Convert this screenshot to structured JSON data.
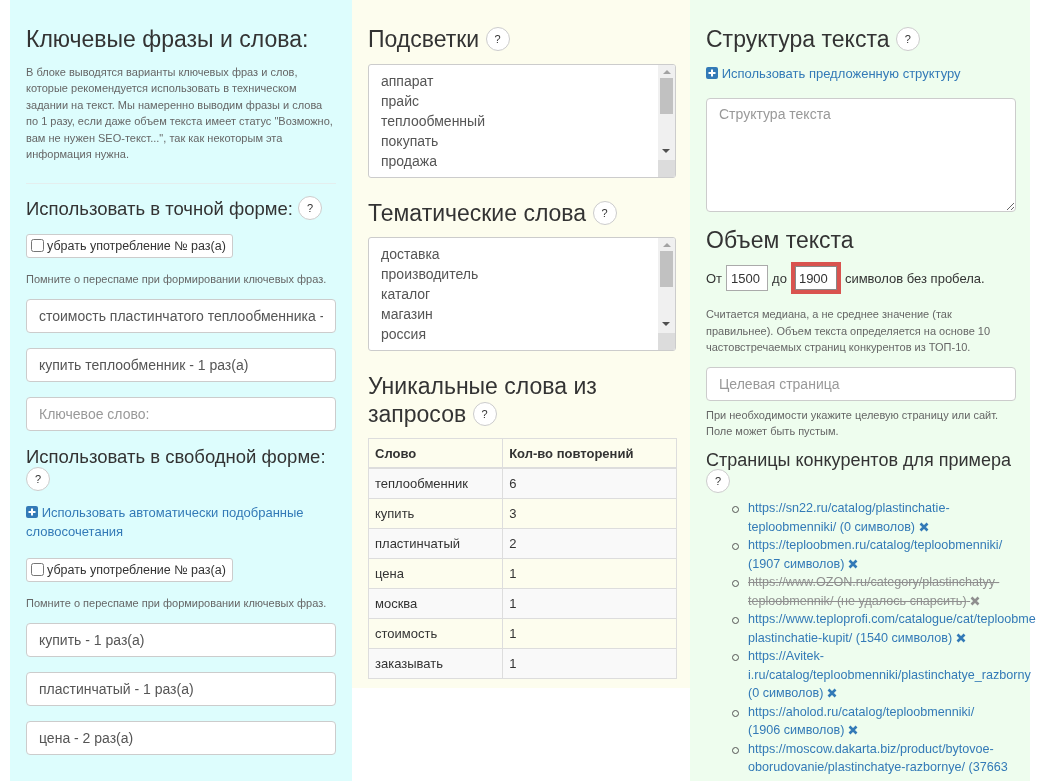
{
  "keywords": {
    "title": "Ключевые фразы и слова:",
    "description": "В блоке выводятся варианты ключевых фраз и слов, которые рекомендуется использовать в техническом задании на текст. Мы намеренно выводим фразы и слова по 1 разу, если даже объем текста имеет статус \"Возможно, вам не нужен SEO-текст...\", так как некоторым эта информация нужна.",
    "exact": {
      "heading": "Использовать в точной форме:",
      "help": "?",
      "remove_count": {
        "label": "убрать употребление № раз(а)",
        "checked": false
      },
      "hint": "Помните о переспаме при формировании ключевых фраз.",
      "phrases": [
        {
          "value": "стоимость пластинчатого теплообменника -"
        },
        {
          "value": "купить теплообменник - 1 раз(а)"
        },
        {
          "placeholder": "Ключевое слово:"
        }
      ]
    },
    "free": {
      "heading": "Использовать в свободной форме:",
      "help": "?",
      "link": "Использовать автоматически подобранные словосочетания",
      "remove_count": {
        "label": "убрать употребление № раз(а)",
        "checked": false
      },
      "hint": "Помните о переспаме при формировании ключевых фраз.",
      "phrases": [
        {
          "value": "купить - 1 раз(а)"
        },
        {
          "value": "пластинчатый - 1 раз(а)"
        },
        {
          "value": "цена - 2 раз(а)"
        }
      ]
    }
  },
  "highlights": {
    "title": "Подсветки",
    "help": "?",
    "items": [
      "аппарат",
      "прайс",
      "теплообменный",
      "покупать",
      "продажа"
    ]
  },
  "thematic": {
    "title": "Тематические слова",
    "help": "?",
    "items": [
      "доставка",
      "производитель",
      "каталог",
      "магазин",
      "россия"
    ]
  },
  "unique_words": {
    "title_lines": [
      "Уникальные слова из",
      "запросов"
    ],
    "help": "?",
    "columns": [
      "Слово",
      "Кол-во повторений"
    ],
    "rows": [
      [
        "теплообменник",
        "6"
      ],
      [
        "купить",
        "3"
      ],
      [
        "пластинчатый",
        "2"
      ],
      [
        "цена",
        "1"
      ],
      [
        "москва",
        "1"
      ],
      [
        "стоимость",
        "1"
      ],
      [
        "заказывать",
        "1"
      ]
    ]
  },
  "structure": {
    "title": "Структура текста",
    "help": "?",
    "link": "Использовать предложенную структуру",
    "placeholder": "Структура текста"
  },
  "volume": {
    "title": "Объем текста",
    "from_label": "От",
    "from_value": "1500",
    "to_label": "до",
    "to_value": "1900",
    "to_highlighted": true,
    "suffix": "символов без пробела.",
    "note": "Считается медиана, а не среднее значение (так правильнее). Объем текста определяется на основе 10 частовстречаемых страниц конкурентов из ТОП-10."
  },
  "target": {
    "placeholder": "Целевая страница",
    "hint": "При необходимости укажите целевую страницу или сайт. Поле может быть пустым."
  },
  "competitors": {
    "title": "Страницы конкурентов для примера",
    "help": "?",
    "pages": [
      {
        "lines": [
          "https://sn22.ru/catalog/plastinchatie-",
          "teploobmenniki/ (0 символов)"
        ],
        "failed": false
      },
      {
        "lines": [
          "https://teploobmen.ru/catalog/teploobmenniki/",
          "(1907 символов)"
        ],
        "failed": false
      },
      {
        "lines": [
          "https://www.OZON.ru/category/plastinchatyy-",
          "teploobmennik/ (не удалось спарсить)"
        ],
        "failed": true
      },
      {
        "lines": [
          "https://www.teploprofi.com/catalogue/cat/teploobme",
          "plastinchatie-kupit/ (1540 символов)"
        ],
        "failed": false
      },
      {
        "lines": [
          "https://Avitek-",
          "i.ru/catalog/teploobmenniki/plastinchatye_razborny",
          "(0 символов)"
        ],
        "failed": false
      },
      {
        "lines": [
          "https://aholod.ru/catalog/teploobmenniki/",
          "(1906 символов)"
        ],
        "failed": false
      },
      {
        "lines": [
          "https://moscow.dakarta.biz/product/bytovoe-",
          "oborudovanie/plastinchatye-razbornye/ (37663"
        ],
        "failed": false,
        "cut": true
      }
    ]
  }
}
